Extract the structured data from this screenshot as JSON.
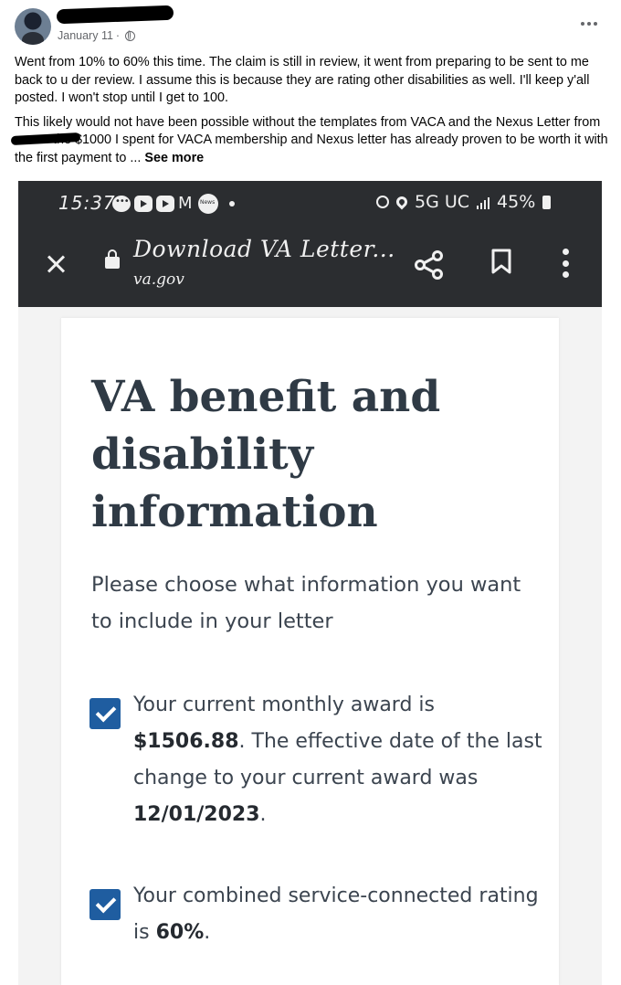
{
  "post": {
    "date": "January 11",
    "separator": "·",
    "paragraph1": "Went from 10% to 60% this time. The claim is still in review,  it went from preparing to be sent to me back to u der review. I assume this is because they are rating other disabilities as well. I'll keep y'all posted. I won't stop until I get to 100.",
    "paragraph2_before": "This likely would not have been possible without the templates from VACA and the Nexus Letter from",
    "paragraph2_after": " the $1000 I spent for VACA membership and Nexus letter has already proven to be worth it with the first payment to ...",
    "see_more": "See more"
  },
  "phone": {
    "status_time": "15:37",
    "network": "5G UC",
    "battery": "45%",
    "browser_title": "Download VA Letter...",
    "browser_url": "va.gov"
  },
  "va_page": {
    "heading": "VA benefit and disability information",
    "subtitle": "Please choose what information you want to include in your letter",
    "option1": {
      "text_a": "Your current monthly award is ",
      "amount": "$1506.88",
      "text_b": ". The effective date of the last change to your current award was ",
      "date": "12/01/2023",
      "text_c": "."
    },
    "option2": {
      "text_a": "Your combined service-connected rating is ",
      "rating": "60%",
      "text_b": "."
    }
  },
  "colors": {
    "checkbox": "#1f5da0",
    "heading": "#2f3a45",
    "status_bar": "#2b2d30"
  }
}
